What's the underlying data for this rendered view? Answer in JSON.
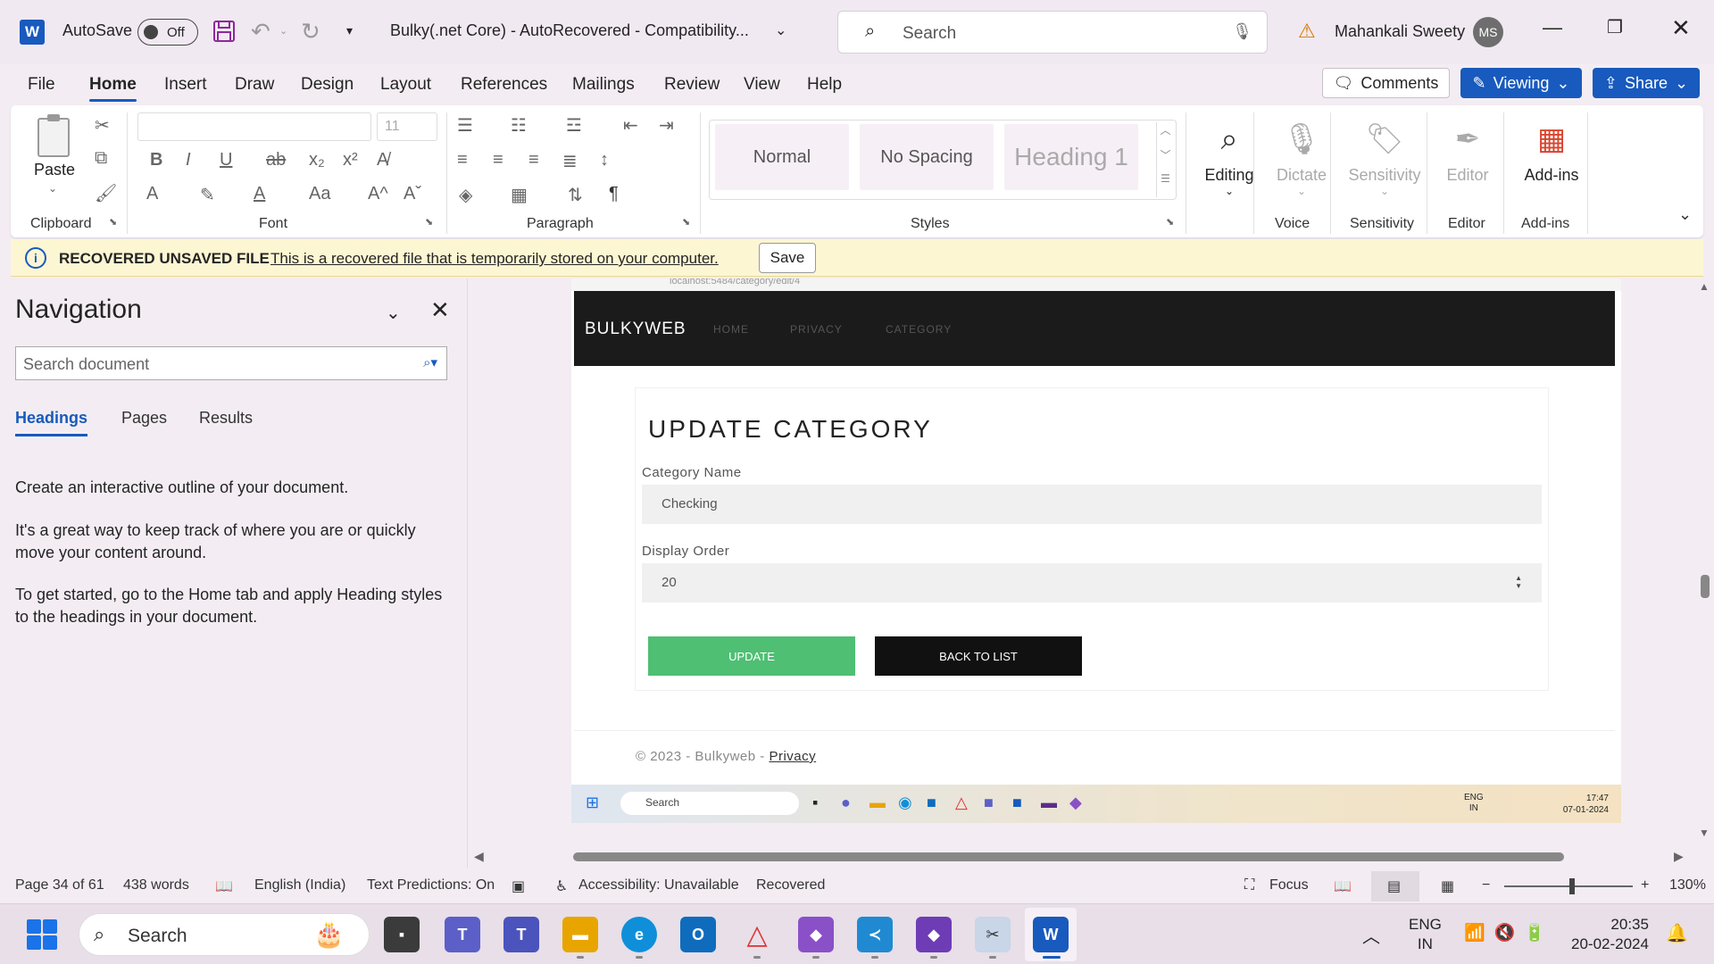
{
  "titlebar": {
    "app_logo": "W",
    "autosave_label": "AutoSave",
    "autosave_state": "Off",
    "doc_title": "Bulky(.net Core)  -  AutoRecovered  -  Compatibility...",
    "search_placeholder": "Search",
    "user_name": "Mahankali Sweety",
    "user_initials": "MS"
  },
  "tabs": [
    "File",
    "Home",
    "Insert",
    "Draw",
    "Design",
    "Layout",
    "References",
    "Mailings",
    "Review",
    "View",
    "Help"
  ],
  "active_tab": "Home",
  "actions": {
    "comments": "Comments",
    "viewing": "Viewing",
    "share": "Share"
  },
  "ribbon": {
    "paste_label": "Paste",
    "font_size": "11",
    "styles": [
      "Normal",
      "No Spacing",
      "Heading 1"
    ],
    "editing_label": "Editing",
    "dictate_label": "Dictate",
    "sensitivity_label": "Sensitivity",
    "editor_label": "Editor",
    "addins_label": "Add-ins",
    "groups": {
      "clipboard": "Clipboard",
      "font": "Font",
      "paragraph": "Paragraph",
      "styles": "Styles",
      "voice": "Voice",
      "sensitivity": "Sensitivity",
      "editor": "Editor",
      "addins": "Add-ins"
    }
  },
  "infobar": {
    "title": "RECOVERED UNSAVED FILE",
    "message": "This is a recovered file that is temporarily stored on your computer.",
    "save_label": "Save"
  },
  "navigation": {
    "title": "Navigation",
    "search_placeholder": "Search document",
    "tabs": [
      "Headings",
      "Pages",
      "Results"
    ],
    "para1": "Create an interactive outline of your document.",
    "para2": "It's a great way to keep track of where you are or quickly move your content around.",
    "para3": "To get started, go to the Home tab and apply Heading styles to the headings in your document."
  },
  "embedded": {
    "url": "localhost:5484/category/edit/4",
    "brand": "BULKYWEB",
    "nav_links": [
      "HOME",
      "PRIVACY",
      "CATEGORY"
    ],
    "card_title": "UPDATE CATEGORY",
    "category_name_label": "Category Name",
    "category_name_value": "Checking",
    "display_order_label": "Display Order",
    "display_order_value": "20",
    "update_label": "UPDATE",
    "back_label": "BACK TO LIST",
    "footer_text": "© 2023 - Bulkyweb - ",
    "footer_link": "Privacy",
    "taskbar_search": "Search",
    "tray_lang_1": "ENG",
    "tray_lang_2": "IN",
    "tray_time": "17:47",
    "tray_date": "07-01-2024"
  },
  "statusbar": {
    "page": "Page 34 of 61",
    "words": "438 words",
    "language": "English (India)",
    "predictions": "Text Predictions: On",
    "accessibility": "Accessibility: Unavailable",
    "recovered": "Recovered",
    "focus": "Focus",
    "zoom": "130%"
  },
  "taskbar": {
    "search_placeholder": "Search",
    "lang_1": "ENG",
    "lang_2": "IN",
    "time": "20:35",
    "date": "20-02-2024"
  },
  "colors": {
    "accent": "#185abd",
    "update_button": "#4fbf74",
    "infobar_bg": "#fdf6d3"
  }
}
